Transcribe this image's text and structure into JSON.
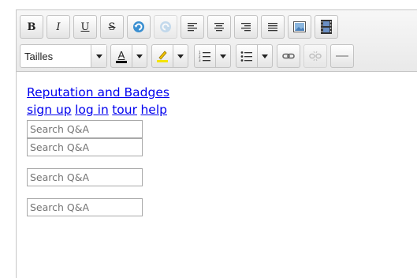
{
  "toolbar": {
    "row1": [
      {
        "name": "bold-button",
        "label": "B",
        "style": "b"
      },
      {
        "name": "italic-button",
        "label": "I",
        "style": "i"
      },
      {
        "name": "underline-button",
        "label": "U",
        "style": "u"
      },
      {
        "name": "strikethrough-button",
        "label": "S",
        "style": "s"
      }
    ],
    "font_size_select": {
      "value": "Tailles"
    },
    "text_color_letter": "A",
    "colors": {
      "text_color": "#000000",
      "highlight_color": "#f4e400",
      "undo_blue": "#3a8fd1"
    }
  },
  "content": {
    "link_title": "Reputation and Badges",
    "links": [
      "sign up",
      "log in",
      "tour",
      "help"
    ],
    "search_placeholder": "Search Q&A"
  }
}
